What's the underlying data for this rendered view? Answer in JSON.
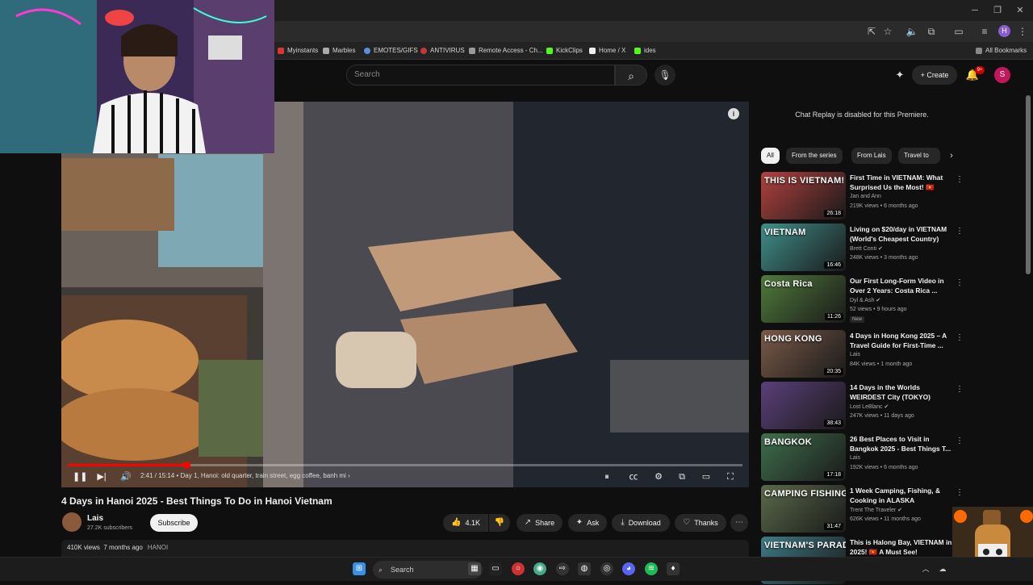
{
  "browser": {
    "bookmarks": [
      "Myinstants",
      "Marbles",
      "EMOTES/GIFS",
      "ANTIVIRUS",
      "Remote Access - Ch...",
      "KickClips",
      "Home / X",
      "ides"
    ],
    "all_bookmarks_label": "All Bookmarks",
    "profile_initial": "H"
  },
  "header": {
    "search_placeholder": "Search",
    "create_label": "Create",
    "notification_count": "9+",
    "account_initial": "S"
  },
  "player": {
    "time": "2:41 / 15:14",
    "chapter": "• Day 1, Hanoi: old quarter, train street, egg coffee, banh mi",
    "chapter_arrow": "›",
    "progress": 0.176
  },
  "video": {
    "title": "4 Days in Hanoi 2025 - Best Things To Do in Hanoi Vietnam",
    "channel": "Lais",
    "subscribers": "27.2K subscribers",
    "subscribe_label": "Subscribe",
    "likes": "4.1K",
    "share_label": "Share",
    "ask_label": "Ask",
    "download_label": "Download",
    "thanks_label": "Thanks",
    "views": "410K views",
    "age": "7 months ago",
    "tag": "HANOI"
  },
  "sidebar": {
    "chat_replay_text": "Chat Replay is disabled for this Premiere.",
    "chips": [
      "All",
      "From the series",
      "From Lais",
      "Travel to"
    ],
    "recommendations": [
      {
        "title": "First Time in VIETNAM: What Surprised Us the Most! 🇻🇳",
        "channel": "Jan and Ann",
        "meta": "219K views • 6 months ago",
        "duration": "26:18",
        "thumb_text": "THIS IS VIETNAM!",
        "thumb_color": "#b0413e"
      },
      {
        "title": "Living on $20/day in VIETNAM (World's Cheapest Country)",
        "channel": "Brett Conti ✔",
        "meta": "248K views • 3 months ago",
        "duration": "16:46",
        "thumb_text": "VIETNAM",
        "thumb_color": "#3f8f8a"
      },
      {
        "title": "Our First Long-Form Video in Over 2 Years: Costa Rica ...",
        "channel": "Dyl & Ash ✔",
        "meta": "52 views • 9 hours ago",
        "duration": "11:26",
        "badge": "New",
        "thumb_text": "Costa Rica",
        "thumb_color": "#4f7a3a"
      },
      {
        "title": "4 Days in Hong Kong 2025 – A Travel Guide for First-Time ...",
        "channel": "Lais",
        "meta": "84K views • 1 month ago",
        "duration": "20:35",
        "thumb_text": "HONG KONG",
        "thumb_color": "#7a5a48"
      },
      {
        "title": "14 Days in the Worlds WEIRDEST City (TOKYO)",
        "channel": "Lost LeBlanc ✔",
        "meta": "247K views • 11 days ago",
        "duration": "38:43",
        "thumb_text": "",
        "thumb_color": "#5b3f7a"
      },
      {
        "title": "26 Best Places to Visit in Bangkok 2025 - Best Things T...",
        "channel": "Lais",
        "meta": "192K views • 6 months ago",
        "duration": "17:18",
        "thumb_text": "BANGKOK",
        "thumb_color": "#3f6e4c"
      },
      {
        "title": "1 Week Camping, Fishing, & Cooking in ALASKA",
        "channel": "Trent The Traveler ✔",
        "meta": "626K views • 11 months ago",
        "duration": "31:47",
        "thumb_text": "CAMPING FISHING COOKING",
        "thumb_color": "#5a6a4a"
      },
      {
        "title": "This is Halong Bay, VIETNAM in 2025! 🇻🇳 A Must See!",
        "channel": "",
        "meta": "",
        "duration": "",
        "thumb_text": "VIETNAM'S PARADISE!",
        "thumb_color": "#3e7a86"
      }
    ]
  },
  "taskbar": {
    "search_label": "Search"
  }
}
